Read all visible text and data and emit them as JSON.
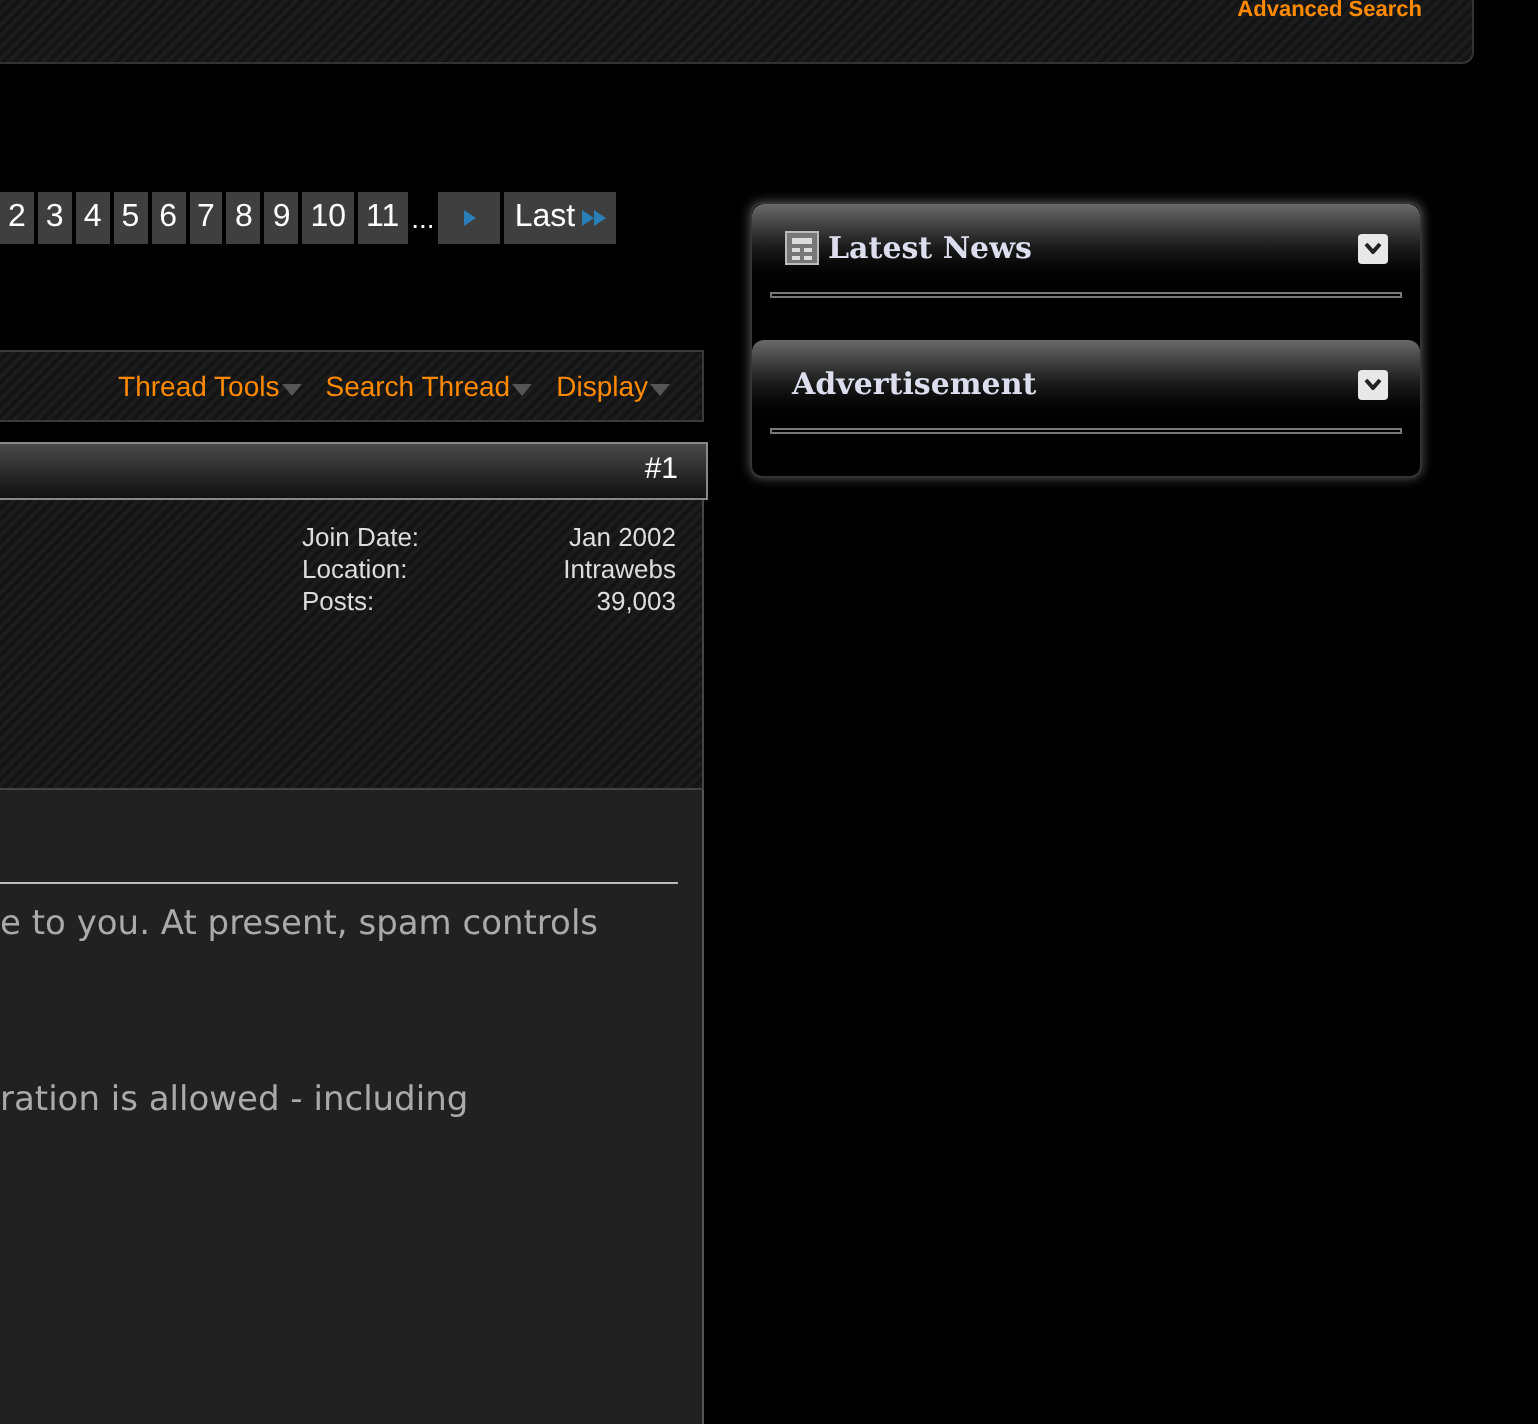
{
  "top_panel": {
    "link": "Advanced Search"
  },
  "pagination": {
    "pages": [
      "2",
      "3",
      "4",
      "5",
      "6",
      "7",
      "8",
      "9",
      "10",
      "11"
    ],
    "ellipsis": "...",
    "last": "Last"
  },
  "thread_toolbar": {
    "menus": [
      "Thread Tools",
      "Search Thread",
      "Display"
    ]
  },
  "post": {
    "number": "#1",
    "user_info": [
      {
        "label": "Join Date:",
        "value": "Jan 2002"
      },
      {
        "label": "Location:",
        "value": "Intrawebs"
      },
      {
        "label": "Posts:",
        "value": "39,003"
      }
    ],
    "body_lines": [
      "e to you. At present, spam controls",
      "ration is allowed - including"
    ]
  },
  "sidebar": {
    "blocks": [
      {
        "title": "Latest News",
        "kind": "news"
      },
      {
        "title": "Advertisement",
        "kind": "plain"
      }
    ]
  }
}
